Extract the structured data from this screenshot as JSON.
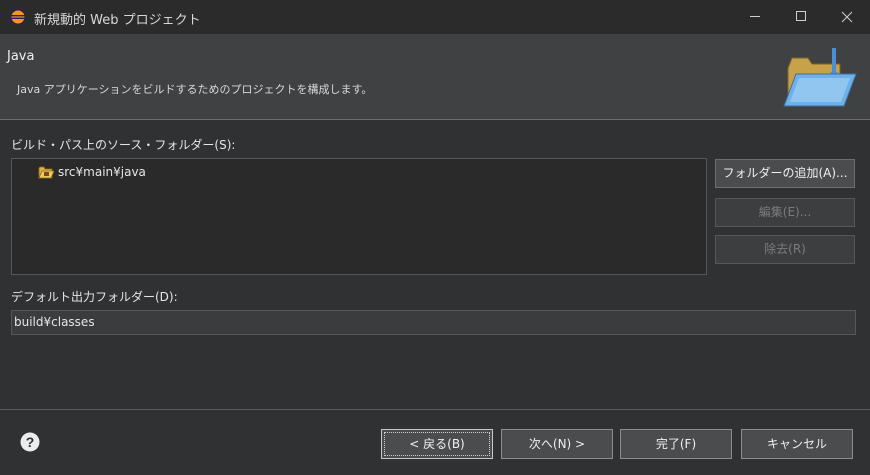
{
  "window": {
    "title": "新規動的 Web プロジェクト",
    "app_icon": "eclipse-icon"
  },
  "header": {
    "title": "Java",
    "description": "Java アプリケーションをビルドするためのプロジェクトを構成します。",
    "banner_icon": "open-folder-wizard-icon"
  },
  "source_folders": {
    "label": "ビルド・パス上のソース・フォルダー(S):",
    "items": [
      {
        "label": "src¥main¥java",
        "icon": "source-folder-icon"
      }
    ]
  },
  "buttons": {
    "add_folder": "フォルダーの追加(A)...",
    "edit": "編集(E)...",
    "remove": "除去(R)"
  },
  "output_folder": {
    "label": "デフォルト出力フォルダー(D):",
    "value": "build¥classes"
  },
  "footer": {
    "help_icon": "help-icon",
    "back": "< 戻る(B)",
    "next": "次へ(N) >",
    "finish": "完了(F)",
    "cancel": "キャンセル"
  },
  "colors": {
    "background": "#2f3133",
    "header_background": "#3f4143",
    "titlebar": "#2b2b2b"
  }
}
